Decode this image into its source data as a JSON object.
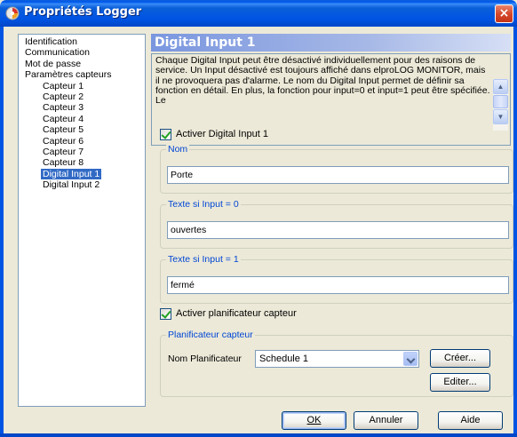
{
  "window": {
    "title": "Propriétés Logger",
    "close_label": "×"
  },
  "tree": {
    "items": [
      {
        "label": "Identification",
        "level": 0,
        "selected": false
      },
      {
        "label": "Communication",
        "level": 0,
        "selected": false
      },
      {
        "label": "Mot de passe",
        "level": 0,
        "selected": false
      },
      {
        "label": "Paramètres capteurs",
        "level": 0,
        "selected": false
      },
      {
        "label": "Capteur 1",
        "level": 1,
        "selected": false
      },
      {
        "label": "Capteur 2",
        "level": 1,
        "selected": false
      },
      {
        "label": "Capteur 3",
        "level": 1,
        "selected": false
      },
      {
        "label": "Capteur 4",
        "level": 1,
        "selected": false
      },
      {
        "label": "Capteur 5",
        "level": 1,
        "selected": false
      },
      {
        "label": "Capteur 6",
        "level": 1,
        "selected": false
      },
      {
        "label": "Capteur 7",
        "level": 1,
        "selected": false
      },
      {
        "label": "Capteur 8",
        "level": 1,
        "selected": false
      },
      {
        "label": "Digital Input 1",
        "level": 1,
        "selected": true
      },
      {
        "label": "Digital Input 2",
        "level": 1,
        "selected": false
      }
    ]
  },
  "panel": {
    "header": "Digital Input 1",
    "description": "Chaque Digital Input peut être désactivé individuellement pour des raisons de service. Un Input désactivé est toujours affiché dans elproLOG MONITOR, mais il ne provoquera pas d'alarme. Le nom du Digital Input permet de définir sa fonction en détail. En plus, la fonction pour input=0 et input=1 peut être spécifiée. Le",
    "activate_label": "Activer Digital Input 1",
    "activate_checked": true,
    "name_group": {
      "legend": "Nom",
      "value": "Porte"
    },
    "input0_group": {
      "legend": "Texte si Input = 0",
      "value": "ouvertes"
    },
    "input1_group": {
      "legend": "Texte si Input = 1",
      "value": "fermé"
    },
    "scheduler_check_label": "Activer planificateur capteur",
    "scheduler_checked": true,
    "scheduler_group": {
      "legend": "Planificateur capteur",
      "name_label": "Nom Planificateur",
      "selected": "Schedule 1",
      "create_button": "Créer...",
      "edit_button": "Editer..."
    }
  },
  "footer": {
    "ok_button": "OK",
    "cancel_button": "Annuler",
    "help_button": "Aide"
  }
}
